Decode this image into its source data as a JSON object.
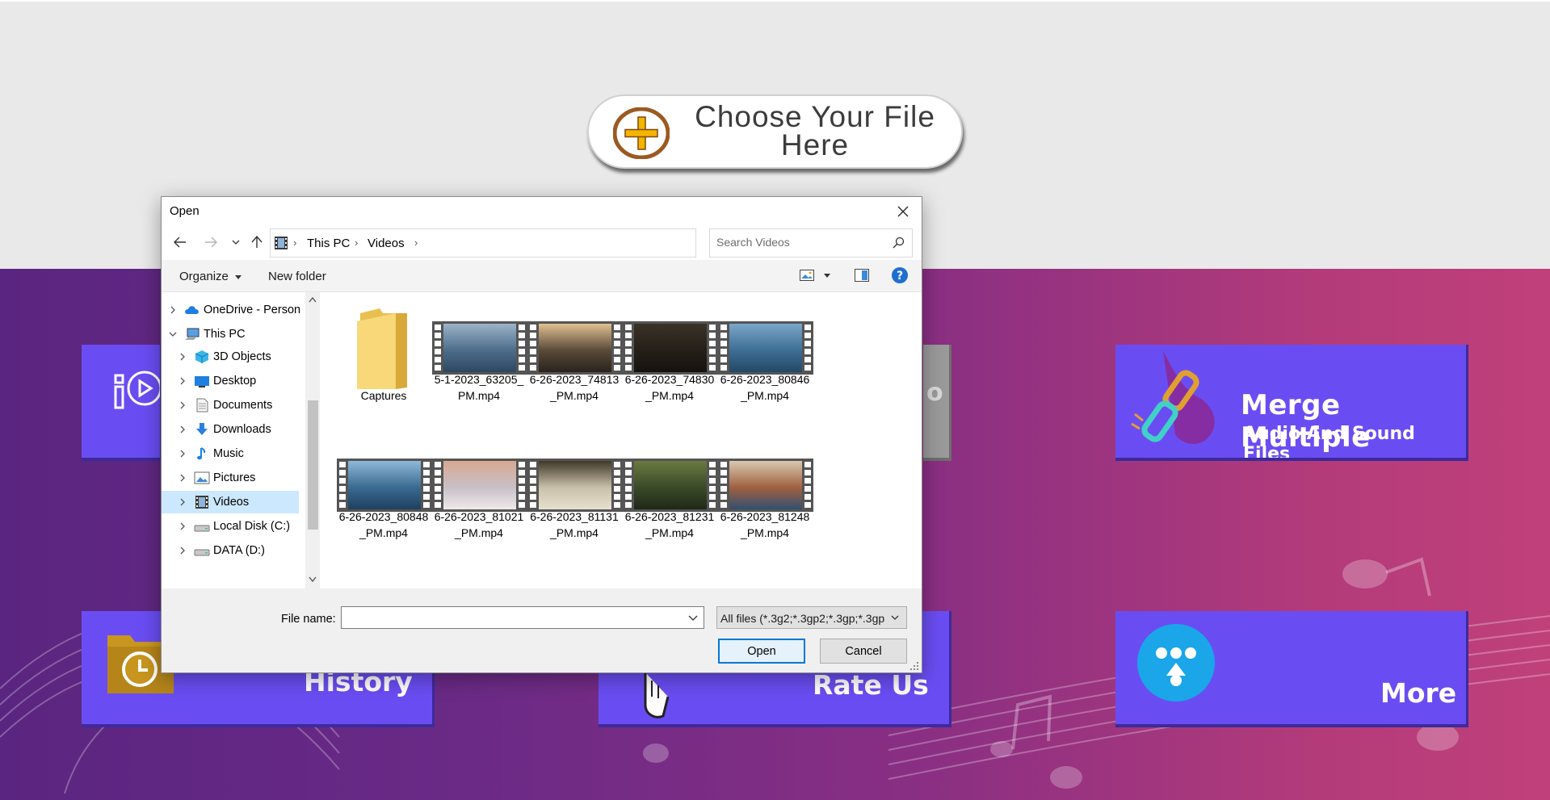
{
  "app": {
    "choose_button": {
      "line1": "Choose Your File",
      "line2": "Here"
    },
    "tiles": {
      "merge": {
        "line1": "Merge Multiple",
        "line2": "Audio And Sound Files"
      },
      "history": {
        "label": "History"
      },
      "rate": {
        "label": "Rate Us"
      },
      "more": {
        "label": "More"
      },
      "grey_partial": {
        "label": "o"
      }
    }
  },
  "dialog": {
    "title": "Open",
    "address": {
      "parts": [
        "This PC",
        "Videos"
      ]
    },
    "search": {
      "placeholder": "Search Videos"
    },
    "toolbar": {
      "organize": "Organize",
      "new_folder": "New folder"
    },
    "nav_tree": [
      {
        "label": "OneDrive - Person",
        "icon": "cloud-icon",
        "level": 0,
        "selected": false
      },
      {
        "label": "This PC",
        "icon": "computer-icon",
        "level": 0,
        "expanded": true,
        "selected": false
      },
      {
        "label": "3D Objects",
        "icon": "cube-icon",
        "level": 1,
        "selected": false
      },
      {
        "label": "Desktop",
        "icon": "desktop-icon",
        "level": 1,
        "selected": false
      },
      {
        "label": "Documents",
        "icon": "document-icon",
        "level": 1,
        "selected": false
      },
      {
        "label": "Downloads",
        "icon": "download-icon",
        "level": 1,
        "selected": false
      },
      {
        "label": "Music",
        "icon": "music-note-icon",
        "level": 1,
        "selected": false
      },
      {
        "label": "Pictures",
        "icon": "picture-icon",
        "level": 1,
        "selected": false
      },
      {
        "label": "Videos",
        "icon": "film-icon",
        "level": 1,
        "selected": true
      },
      {
        "label": "Local Disk (C:)",
        "icon": "drive-icon",
        "level": 1,
        "selected": false
      },
      {
        "label": "DATA (D:)",
        "icon": "drive-icon",
        "level": 1,
        "selected": false
      }
    ],
    "files": [
      {
        "name_l1": "Captures",
        "name_l2": "",
        "kind": "folder"
      },
      {
        "name_l1": "5-1-2023_63205_",
        "name_l2": "PM.mp4",
        "kind": "video",
        "scene": "ocean"
      },
      {
        "name_l1": "6-26-2023_74813",
        "name_l2": "_PM.mp4",
        "kind": "video",
        "scene": "forest-sun"
      },
      {
        "name_l1": "6-26-2023_74830",
        "name_l2": "_PM.mp4",
        "kind": "video",
        "scene": "dark-forest"
      },
      {
        "name_l1": "6-26-2023_80846",
        "name_l2": "_PM.mp4",
        "kind": "video",
        "scene": "misty-mountains"
      },
      {
        "name_l1": "6-26-2023_80848",
        "name_l2": "_PM.mp4",
        "kind": "video",
        "scene": "misty-mountains-2"
      },
      {
        "name_l1": "6-26-2023_81021",
        "name_l2": "_PM.mp4",
        "kind": "video",
        "scene": "clouds-pink"
      },
      {
        "name_l1": "6-26-2023_81131",
        "name_l2": "_PM.mp4",
        "kind": "video",
        "scene": "cloud-sea"
      },
      {
        "name_l1": "6-26-2023_81231",
        "name_l2": "_PM.mp4",
        "kind": "video",
        "scene": "tree"
      },
      {
        "name_l1": "6-26-2023_81248",
        "name_l2": "_PM.mp4",
        "kind": "video",
        "scene": "coast"
      }
    ],
    "file_name": {
      "label": "File name:",
      "value": ""
    },
    "file_type": {
      "value": "All files (*.3g2;*.3gp2;*.3gp;*.3gp"
    },
    "buttons": {
      "open": "Open",
      "cancel": "Cancel"
    }
  },
  "colors": {
    "tile_purple": "#6a4df2",
    "selected_row": "#cce8ff",
    "accent_blue": "#0078d7"
  }
}
